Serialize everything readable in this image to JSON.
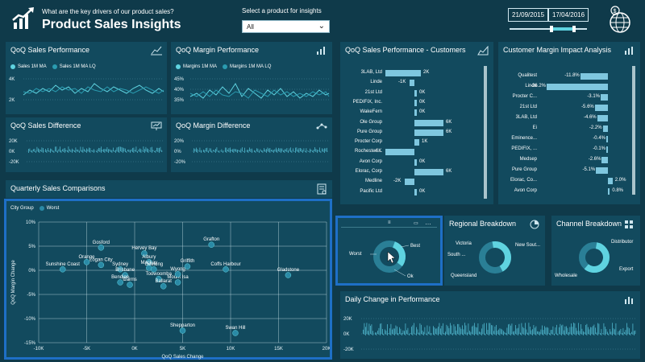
{
  "header": {
    "question": "What are the key drivers of our product sales?",
    "title": "Product Sales Insights",
    "select_label": "Select a product for insights",
    "select_value": "All",
    "date_from": "21/09/2015",
    "date_to": "17/04/2016",
    "slider_level": 0.55
  },
  "colors": {
    "background": "#0f3a4a",
    "panel": "#124a5e",
    "accent": "#5fd3e0",
    "bar": "#7fc7df",
    "highlight": "#1e6fc6"
  },
  "qoq_sales_perf": {
    "title": "QoQ Sales Performance",
    "legend": [
      "Sales 1M MA",
      "Sales 1M MA LQ"
    ],
    "y_ticks": [
      "4K",
      "2K"
    ]
  },
  "qoq_margin_perf": {
    "title": "QoQ Margin Performance",
    "legend": [
      "Margins 1M MA",
      "Margins 1M MA LQ"
    ],
    "y_ticks": [
      "45%",
      "40%",
      "35%"
    ]
  },
  "qoq_sales_diff": {
    "title": "QoQ Sales Difference",
    "y_ticks": [
      "20K",
      "0K",
      "-20K"
    ]
  },
  "qoq_margin_diff": {
    "title": "QoQ Margin Difference",
    "y_ticks": [
      "20%",
      "0%",
      "-20%"
    ]
  },
  "customers": {
    "title": "QoQ Sales Performance - Customers",
    "rows": [
      {
        "name": "3LAB, Ltd",
        "label": "2K",
        "value": 2
      },
      {
        "name": "Linde",
        "label": "-1K",
        "value": -1
      },
      {
        "name": "21st Ltd",
        "label": "0K",
        "value": 0.3
      },
      {
        "name": "PEDIFIX, Inc.",
        "label": "0K",
        "value": 0.2
      },
      {
        "name": "WakeFern",
        "label": "0K",
        "value": 0.1
      },
      {
        "name": "Ole Group",
        "label": "6K",
        "value": 6
      },
      {
        "name": "Pure Group",
        "label": "6K",
        "value": 6
      },
      {
        "name": "Procter Corp",
        "label": "1K",
        "value": 1
      },
      {
        "name": "Rochester ...",
        "label": "-6K",
        "value": -6
      },
      {
        "name": "Avon Corp",
        "label": "0K",
        "value": 0.1
      },
      {
        "name": "Elorac, Corp",
        "label": "6K",
        "value": 6
      },
      {
        "name": "Medline",
        "label": "-2K",
        "value": -2
      },
      {
        "name": "Pacific Ltd",
        "label": "0K",
        "value": 0.1
      }
    ]
  },
  "customer_margin": {
    "title": "Customer Margin Impact Analysis",
    "rows": [
      {
        "name": "Qualitest",
        "label": "-11.8%",
        "value": -11.8
      },
      {
        "name": "Linde",
        "label": "-26.2%",
        "value": -26.2
      },
      {
        "name": "Procter C...",
        "label": "-3.1%",
        "value": -3.1
      },
      {
        "name": "21st Ltd",
        "label": "-5.6%",
        "value": -5.6
      },
      {
        "name": "3LAB, Ltd",
        "label": "-4.6%",
        "value": -4.6
      },
      {
        "name": "Ei",
        "label": "-2.2%",
        "value": -2.2
      },
      {
        "name": "Eminence...",
        "label": "-0.4%",
        "value": -0.4
      },
      {
        "name": "PEDIFIX, ...",
        "label": "-0.1%",
        "value": -0.1
      },
      {
        "name": "Medsep",
        "label": "-2.6%",
        "value": -2.6
      },
      {
        "name": "Pure Group",
        "label": "-5.1%",
        "value": -5.1
      },
      {
        "name": "Elorac, Co...",
        "label": "2.0%",
        "value": 2.0
      },
      {
        "name": "Avon Corp",
        "label": "0.8%",
        "value": 0.8
      }
    ]
  },
  "quarterly": {
    "title": "Quarterly Sales Comparisons",
    "legend_label": "City Group",
    "legend_item": "Worst",
    "xlabel": "QoQ Sales Change",
    "ylabel": "QoQ Margin Change"
  },
  "chart_data": {
    "type": "scatter",
    "xlim": [
      -10000,
      20000
    ],
    "ylim": [
      -0.15,
      0.1
    ],
    "x_ticks": [
      "-10K",
      "-5K",
      "0K",
      "5K",
      "10K",
      "15K",
      "20K"
    ],
    "y_ticks": [
      "10%",
      "5%",
      "0%",
      "-5%",
      "-10%",
      "-15%"
    ],
    "series": [
      {
        "name": "Worst",
        "points": [
          {
            "label": "Sunshine Coast",
            "x": -7500,
            "y": 0.002
          },
          {
            "label": "Gosford",
            "x": -3500,
            "y": 0.047
          },
          {
            "label": "Orange",
            "x": -5000,
            "y": 0.017
          },
          {
            "label": "Logan City",
            "x": -3500,
            "y": 0.011
          },
          {
            "label": "Sydney",
            "x": -1500,
            "y": 0.002
          },
          {
            "label": "Brisbane",
            "x": -1000,
            "y": -0.01
          },
          {
            "label": "Bendige",
            "x": -1500,
            "y": -0.025
          },
          {
            "label": "Cairns",
            "x": -500,
            "y": -0.03
          },
          {
            "label": "Hervey Bay",
            "x": 1000,
            "y": 0.035
          },
          {
            "label": "Albury",
            "x": 1500,
            "y": 0.017
          },
          {
            "label": "Mackay",
            "x": 1500,
            "y": 0.005
          },
          {
            "label": "Geelong",
            "x": 2000,
            "y": 0.002
          },
          {
            "label": "Toowoomba",
            "x": 2500,
            "y": -0.018
          },
          {
            "label": "Ballarat",
            "x": 3000,
            "y": -0.033
          },
          {
            "label": "Mount Isa",
            "x": 4500,
            "y": -0.025
          },
          {
            "label": "Wyong",
            "x": 4500,
            "y": -0.008
          },
          {
            "label": "Griffith",
            "x": 5500,
            "y": 0.008
          },
          {
            "label": "Grafton",
            "x": 8000,
            "y": 0.053
          },
          {
            "label": "Coffs Harbour",
            "x": 9500,
            "y": 0.002
          },
          {
            "label": "Gladstone",
            "x": 16000,
            "y": -0.01
          },
          {
            "label": "Shepparton",
            "x": 5000,
            "y": -0.125
          },
          {
            "label": "Swan Hill",
            "x": 10500,
            "y": -0.13
          }
        ]
      }
    ]
  },
  "donut_main": {
    "labels": [
      "Worst",
      "Best",
      "Ok"
    ]
  },
  "regional": {
    "title": "Regional Breakdown",
    "labels": [
      "Victoria",
      "New Sout...",
      "South ...",
      "Queensland"
    ]
  },
  "channel": {
    "title": "Channel Breakdown",
    "labels": [
      "Distributor",
      "Export",
      "Wholesale"
    ]
  },
  "daily": {
    "title": "Daily Change in Performance",
    "y_ticks": [
      "20K",
      "0K",
      "-20K"
    ]
  }
}
